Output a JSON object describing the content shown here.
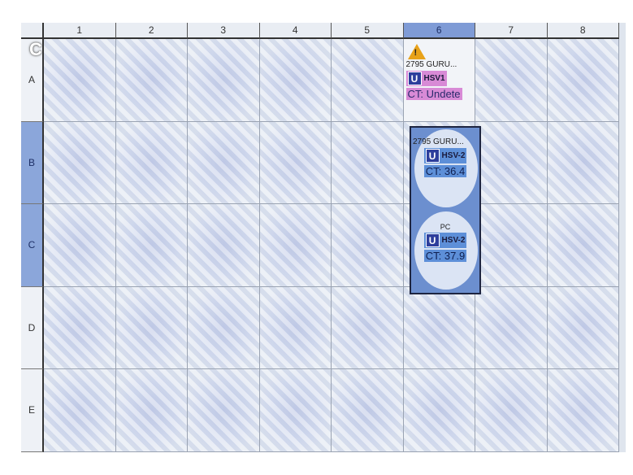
{
  "panel_label": "C",
  "columns": [
    "1",
    "2",
    "3",
    "4",
    "5",
    "6",
    "7",
    "8"
  ],
  "rows": [
    "A",
    "B",
    "C",
    "D",
    "E"
  ],
  "selected_column": "6",
  "selected_rows": [
    "B",
    "C"
  ],
  "wells": {
    "A6": {
      "warning_icon": "warning-triangle-icon",
      "warning_glyph": "!",
      "sample": "2795 GURU...",
      "badge": "U",
      "target": "HSV1",
      "ct": "CT: Undete"
    },
    "B6": {
      "sample": "2795 GURU...",
      "badge": "U",
      "target": "HSV-2",
      "ct": "CT: 36.4"
    },
    "C6": {
      "sample": "PC",
      "badge": "U",
      "target": "HSV-2",
      "ct": "CT: 37.9"
    }
  },
  "colors": {
    "selection": "#6c8fcf",
    "hsv1_highlight": "#d88ad6",
    "hsv2_highlight": "#5d8fd8",
    "warning": "#e8a21a"
  }
}
